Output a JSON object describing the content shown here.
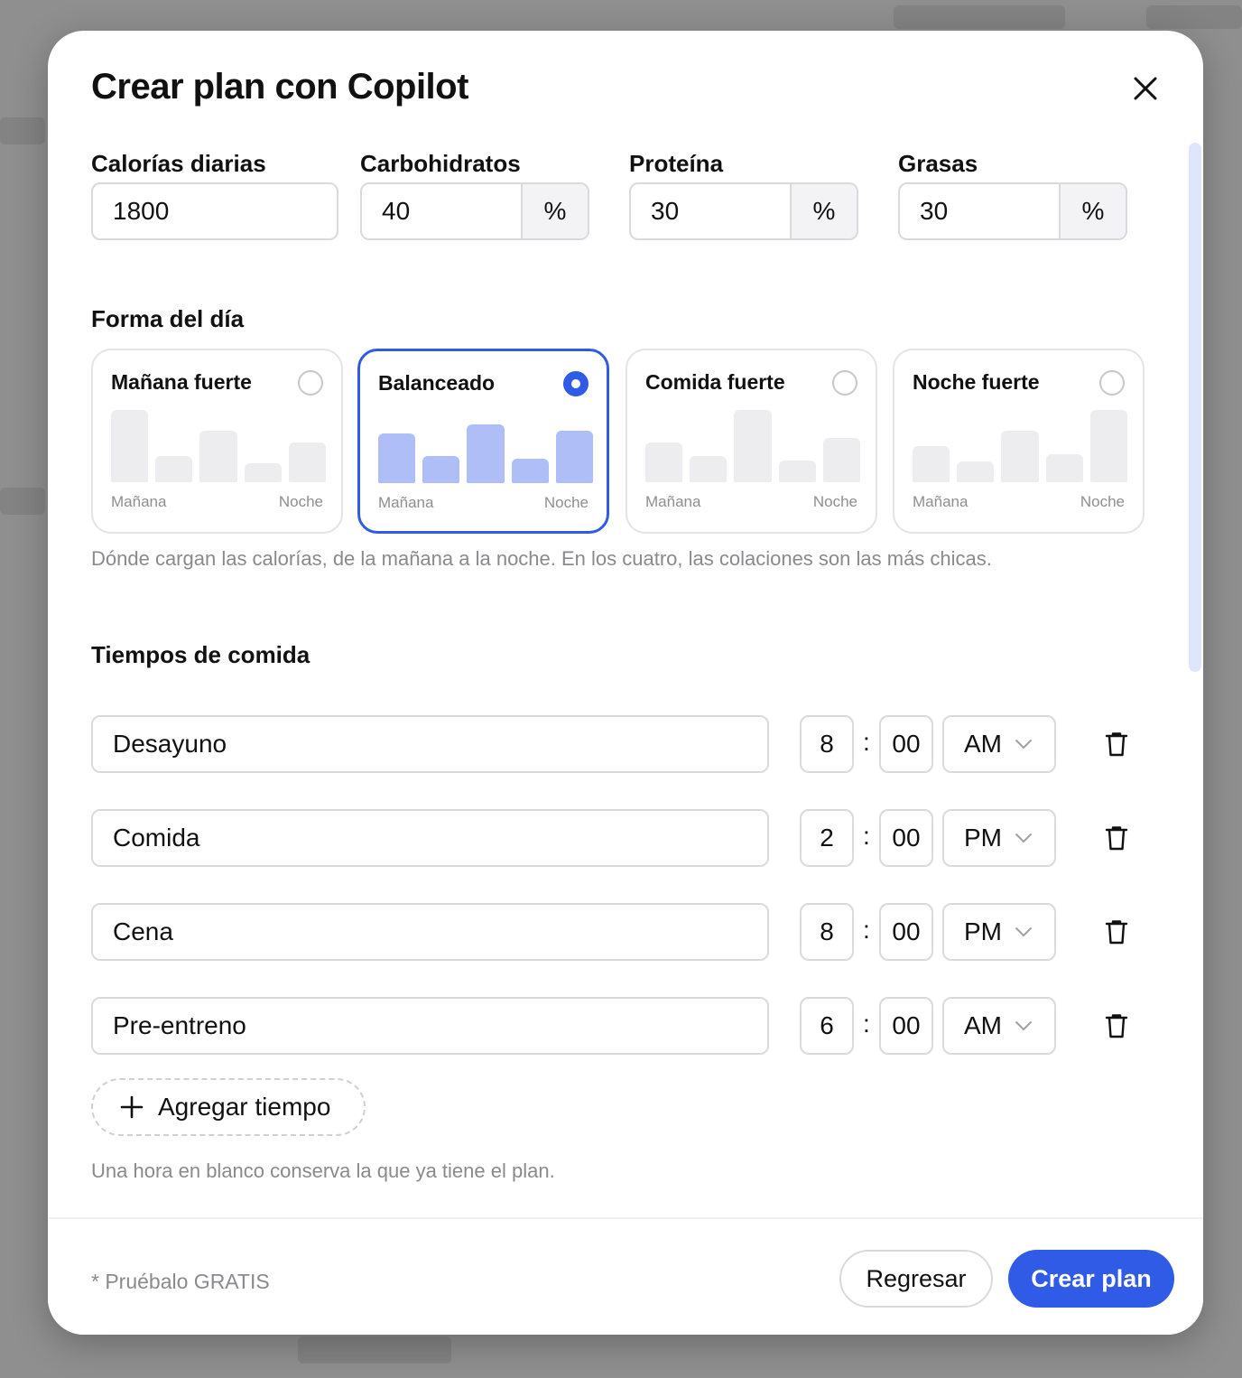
{
  "modal": {
    "title": "Crear plan con Copilot"
  },
  "macros": {
    "calories": {
      "label": "Calorías diarias",
      "value": "1800"
    },
    "carbs": {
      "label": "Carbohidratos",
      "value": "40",
      "unit": "%"
    },
    "protein": {
      "label": "Proteína",
      "value": "30",
      "unit": "%"
    },
    "fats": {
      "label": "Grasas",
      "value": "30",
      "unit": "%"
    }
  },
  "day_shape": {
    "label": "Forma del día",
    "helper": "Dónde cargan las calorías, de la mañana a la noche. En los cuatro, las colaciones son las más chicas.",
    "selected": "balanceado",
    "options": [
      {
        "id": "manana",
        "title": "Mañana fuerte",
        "from": "Mañana",
        "to": "Noche",
        "bars": [
          1.0,
          0.36,
          0.71,
          0.26,
          0.55
        ]
      },
      {
        "id": "balanceado",
        "title": "Balanceado",
        "from": "Mañana",
        "to": "Noche",
        "bars": [
          0.69,
          0.38,
          0.81,
          0.34,
          0.73
        ]
      },
      {
        "id": "comida",
        "title": "Comida fuerte",
        "from": "Mañana",
        "to": "Noche",
        "bars": [
          0.55,
          0.36,
          1.0,
          0.3,
          0.61
        ]
      },
      {
        "id": "noche",
        "title": "Noche fuerte",
        "from": "Mañana",
        "to": "Noche",
        "bars": [
          0.5,
          0.29,
          0.71,
          0.39,
          1.0
        ]
      }
    ]
  },
  "meals": {
    "label": "Tiempos de comida",
    "items": [
      {
        "name": "Desayuno",
        "hour": "8",
        "minute": "00",
        "period": "AM"
      },
      {
        "name": "Comida",
        "hour": "2",
        "minute": "00",
        "period": "PM"
      },
      {
        "name": "Cena",
        "hour": "8",
        "minute": "00",
        "period": "PM"
      },
      {
        "name": "Pre-entreno",
        "hour": "6",
        "minute": "00",
        "period": "AM"
      }
    ],
    "separator": ":",
    "add_label": "Agregar tiempo",
    "helper": "Una hora en blanco conserva la que ya tiene el plan."
  },
  "footer": {
    "note": "* Pruébalo GRATIS",
    "back_label": "Regresar",
    "create_label": "Crear plan"
  },
  "colors": {
    "accent": "#2f5be6",
    "bar_selected": "#b0bef7",
    "bar_default": "#ededf0"
  },
  "icons": {
    "close": "close-icon",
    "trash": "trash-icon",
    "plus": "plus-icon",
    "chevron": "chevron-down-icon"
  }
}
